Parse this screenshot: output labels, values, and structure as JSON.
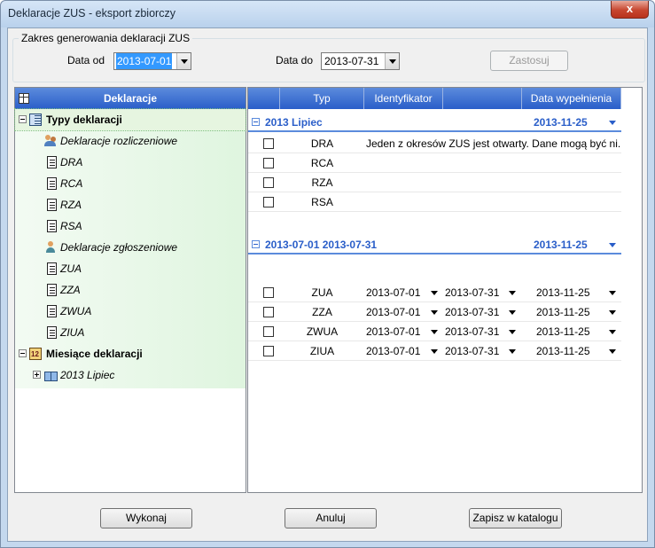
{
  "window": {
    "title": "Deklaracje ZUS - eksport zbiorczy",
    "close_glyph": "x"
  },
  "range": {
    "group_title": "Zakres generowania deklaracji ZUS",
    "date_from_label": "Data od",
    "date_from_value": "2013-07-01",
    "date_to_label": "Data do",
    "date_to_value": "2013-07-31",
    "apply_label": "Zastosuj"
  },
  "tree": {
    "header": "Deklaracje",
    "types_label": "Typy deklaracji",
    "settlement_label": "Deklaracje rozliczeniowe",
    "settlement_items": [
      "DRA",
      "RCA",
      "RZA",
      "RSA"
    ],
    "registration_label": "Deklaracje zgłoszeniowe",
    "registration_items": [
      "ZUA",
      "ZZA",
      "ZWUA",
      "ZIUA"
    ],
    "months_label": "Miesiące deklaracji",
    "month_item": "2013 Lipiec"
  },
  "grid": {
    "columns": [
      "Typ",
      "Identyfikator",
      "",
      "Data wypełnienia"
    ],
    "group1": {
      "label": "2013 Lipiec",
      "date": "2013-11-25",
      "rows": [
        {
          "typ": "DRA",
          "ident": "Jeden z okresów ZUS jest otwarty. Dane mogą być ni..."
        },
        {
          "typ": "RCA",
          "ident": ""
        },
        {
          "typ": "RZA",
          "ident": ""
        },
        {
          "typ": "RSA",
          "ident": ""
        }
      ]
    },
    "group2": {
      "label": "2013-07-01  2013-07-31",
      "date": "2013-11-25",
      "rows": [
        {
          "typ": "ZUA",
          "from": "2013-07-01",
          "to": "2013-07-31",
          "filled": "2013-11-25"
        },
        {
          "typ": "ZZA",
          "from": "2013-07-01",
          "to": "2013-07-31",
          "filled": "2013-11-25"
        },
        {
          "typ": "ZWUA",
          "from": "2013-07-01",
          "to": "2013-07-31",
          "filled": "2013-11-25"
        },
        {
          "typ": "ZIUA",
          "from": "2013-07-01",
          "to": "2013-07-31",
          "filled": "2013-11-25"
        }
      ]
    }
  },
  "buttons": {
    "execute": "Wykonaj",
    "cancel": "Anuluj",
    "save_catalog": "Zapisz w katalogu"
  }
}
